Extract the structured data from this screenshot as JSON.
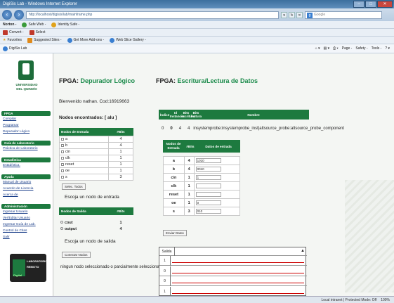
{
  "window": {
    "title": "DigiSis Lab - Windows Internet Explorer"
  },
  "address": {
    "url": "http://localhost/digisis/lab/mainframe.php",
    "search_brand": "Google"
  },
  "toolbar1": {
    "norton": "Norton -",
    "safe_web": "Safe Web -",
    "identity_safe": "Identity Safe -"
  },
  "toolbar2": {
    "convert": "Convert -",
    "select": "Select"
  },
  "toolbar3": {
    "favorites": "Favorites",
    "suggested": "Suggested Sites -",
    "get_more": "Get More Add-ons -",
    "web_slice": "Web Slice Gallery -"
  },
  "tab": {
    "label": "DigiSis Lab",
    "page": "Page -",
    "safety": "Safety -",
    "tools": "Tools -"
  },
  "sidebar": {
    "logo_line1": "UNIVERSIDAD",
    "logo_line2": "DEL QUINDÍO",
    "sections": [
      {
        "title": "FPGA",
        "links": [
          "Compilar",
          "Programar",
          "Depurador Lógico"
        ]
      },
      {
        "title": "Guía de Laboratorio",
        "links": [
          "Práctica de Laboratorio"
        ]
      },
      {
        "title": "Estadística",
        "links": [
          "Estadística."
        ]
      },
      {
        "title": "Ayuda",
        "links": [
          "Manual de Usuario",
          "Acuerdo de Licencia",
          "Acerca de"
        ]
      },
      {
        "title": "Administración",
        "links": [
          "Ingresar Usuario",
          "Ver/Editar Usuario",
          "Ingresar Guía de Lab.",
          "Control de Citas",
          "Salir"
        ]
      }
    ],
    "banner_line1": "LABORATORIO",
    "banner_line2": "REMOTO",
    "banner_side": "Digital"
  },
  "left_panel": {
    "title_prefix": "FPGA:",
    "title_accent": "Depurador Lógico",
    "welcome": "Bienvenido nathan. Cod:16919663",
    "nodes_found": "Nodos encontrados: [ alu ]",
    "input_table": {
      "headers": [
        "Nodos de Entrada",
        "#Bits"
      ],
      "rows": [
        {
          "name": "a",
          "bits": "4"
        },
        {
          "name": "b",
          "bits": "4"
        },
        {
          "name": "cin",
          "bits": "1"
        },
        {
          "name": "clk",
          "bits": "1"
        },
        {
          "name": "reset",
          "bits": "1"
        },
        {
          "name": "oe",
          "bits": "1"
        },
        {
          "name": "s",
          "bits": "3"
        }
      ]
    },
    "select_all": "Selec. Todos",
    "choose_input": "Escoja un nodo de entrada",
    "output_table": {
      "headers": [
        "Nodos de Salida",
        "#Bits"
      ],
      "rows": [
        {
          "name": "cout",
          "bits": "1"
        },
        {
          "name": "output",
          "bits": "4"
        }
      ]
    },
    "choose_output": "Escoja un nodo de salida",
    "connect": "Conectar Nodos",
    "status": "ningun nodo seleccionado o parcialmente seleccionado!"
  },
  "right_panel": {
    "title_prefix": "FPGA:",
    "title_accent": "Escritura/Lectura de Datos",
    "info_headers": [
      "Índice",
      "Id Instancia",
      "Bits escritura",
      "Bits lectura",
      "Nombre"
    ],
    "info_row": [
      "0",
      "0",
      "4",
      "4",
      "insystemprobe:insystemprobe_inst|altsource_probe:altsource_probe_component"
    ],
    "data_headers": [
      "Nodos de Entrada",
      "#Bits",
      "Datos de entrada"
    ],
    "data_rows": [
      {
        "name": "a",
        "bits": "4",
        "value": "1010"
      },
      {
        "name": "b",
        "bits": "4",
        "value": "0010"
      },
      {
        "name": "cin",
        "bits": "1",
        "value": "1"
      },
      {
        "name": "clk",
        "bits": "1",
        "value": ""
      },
      {
        "name": "reset",
        "bits": "1",
        "value": ""
      },
      {
        "name": "oe",
        "bits": "1",
        "value": "0"
      },
      {
        "name": "s",
        "bits": "3",
        "value": "010"
      }
    ],
    "send": "Enviar Datos",
    "wave_header": "Salida",
    "wave_rows": [
      "1",
      "0",
      "0",
      "1"
    ]
  },
  "status": {
    "zone": "Local intranet | Protected Mode: Off",
    "zoom": "100%"
  }
}
